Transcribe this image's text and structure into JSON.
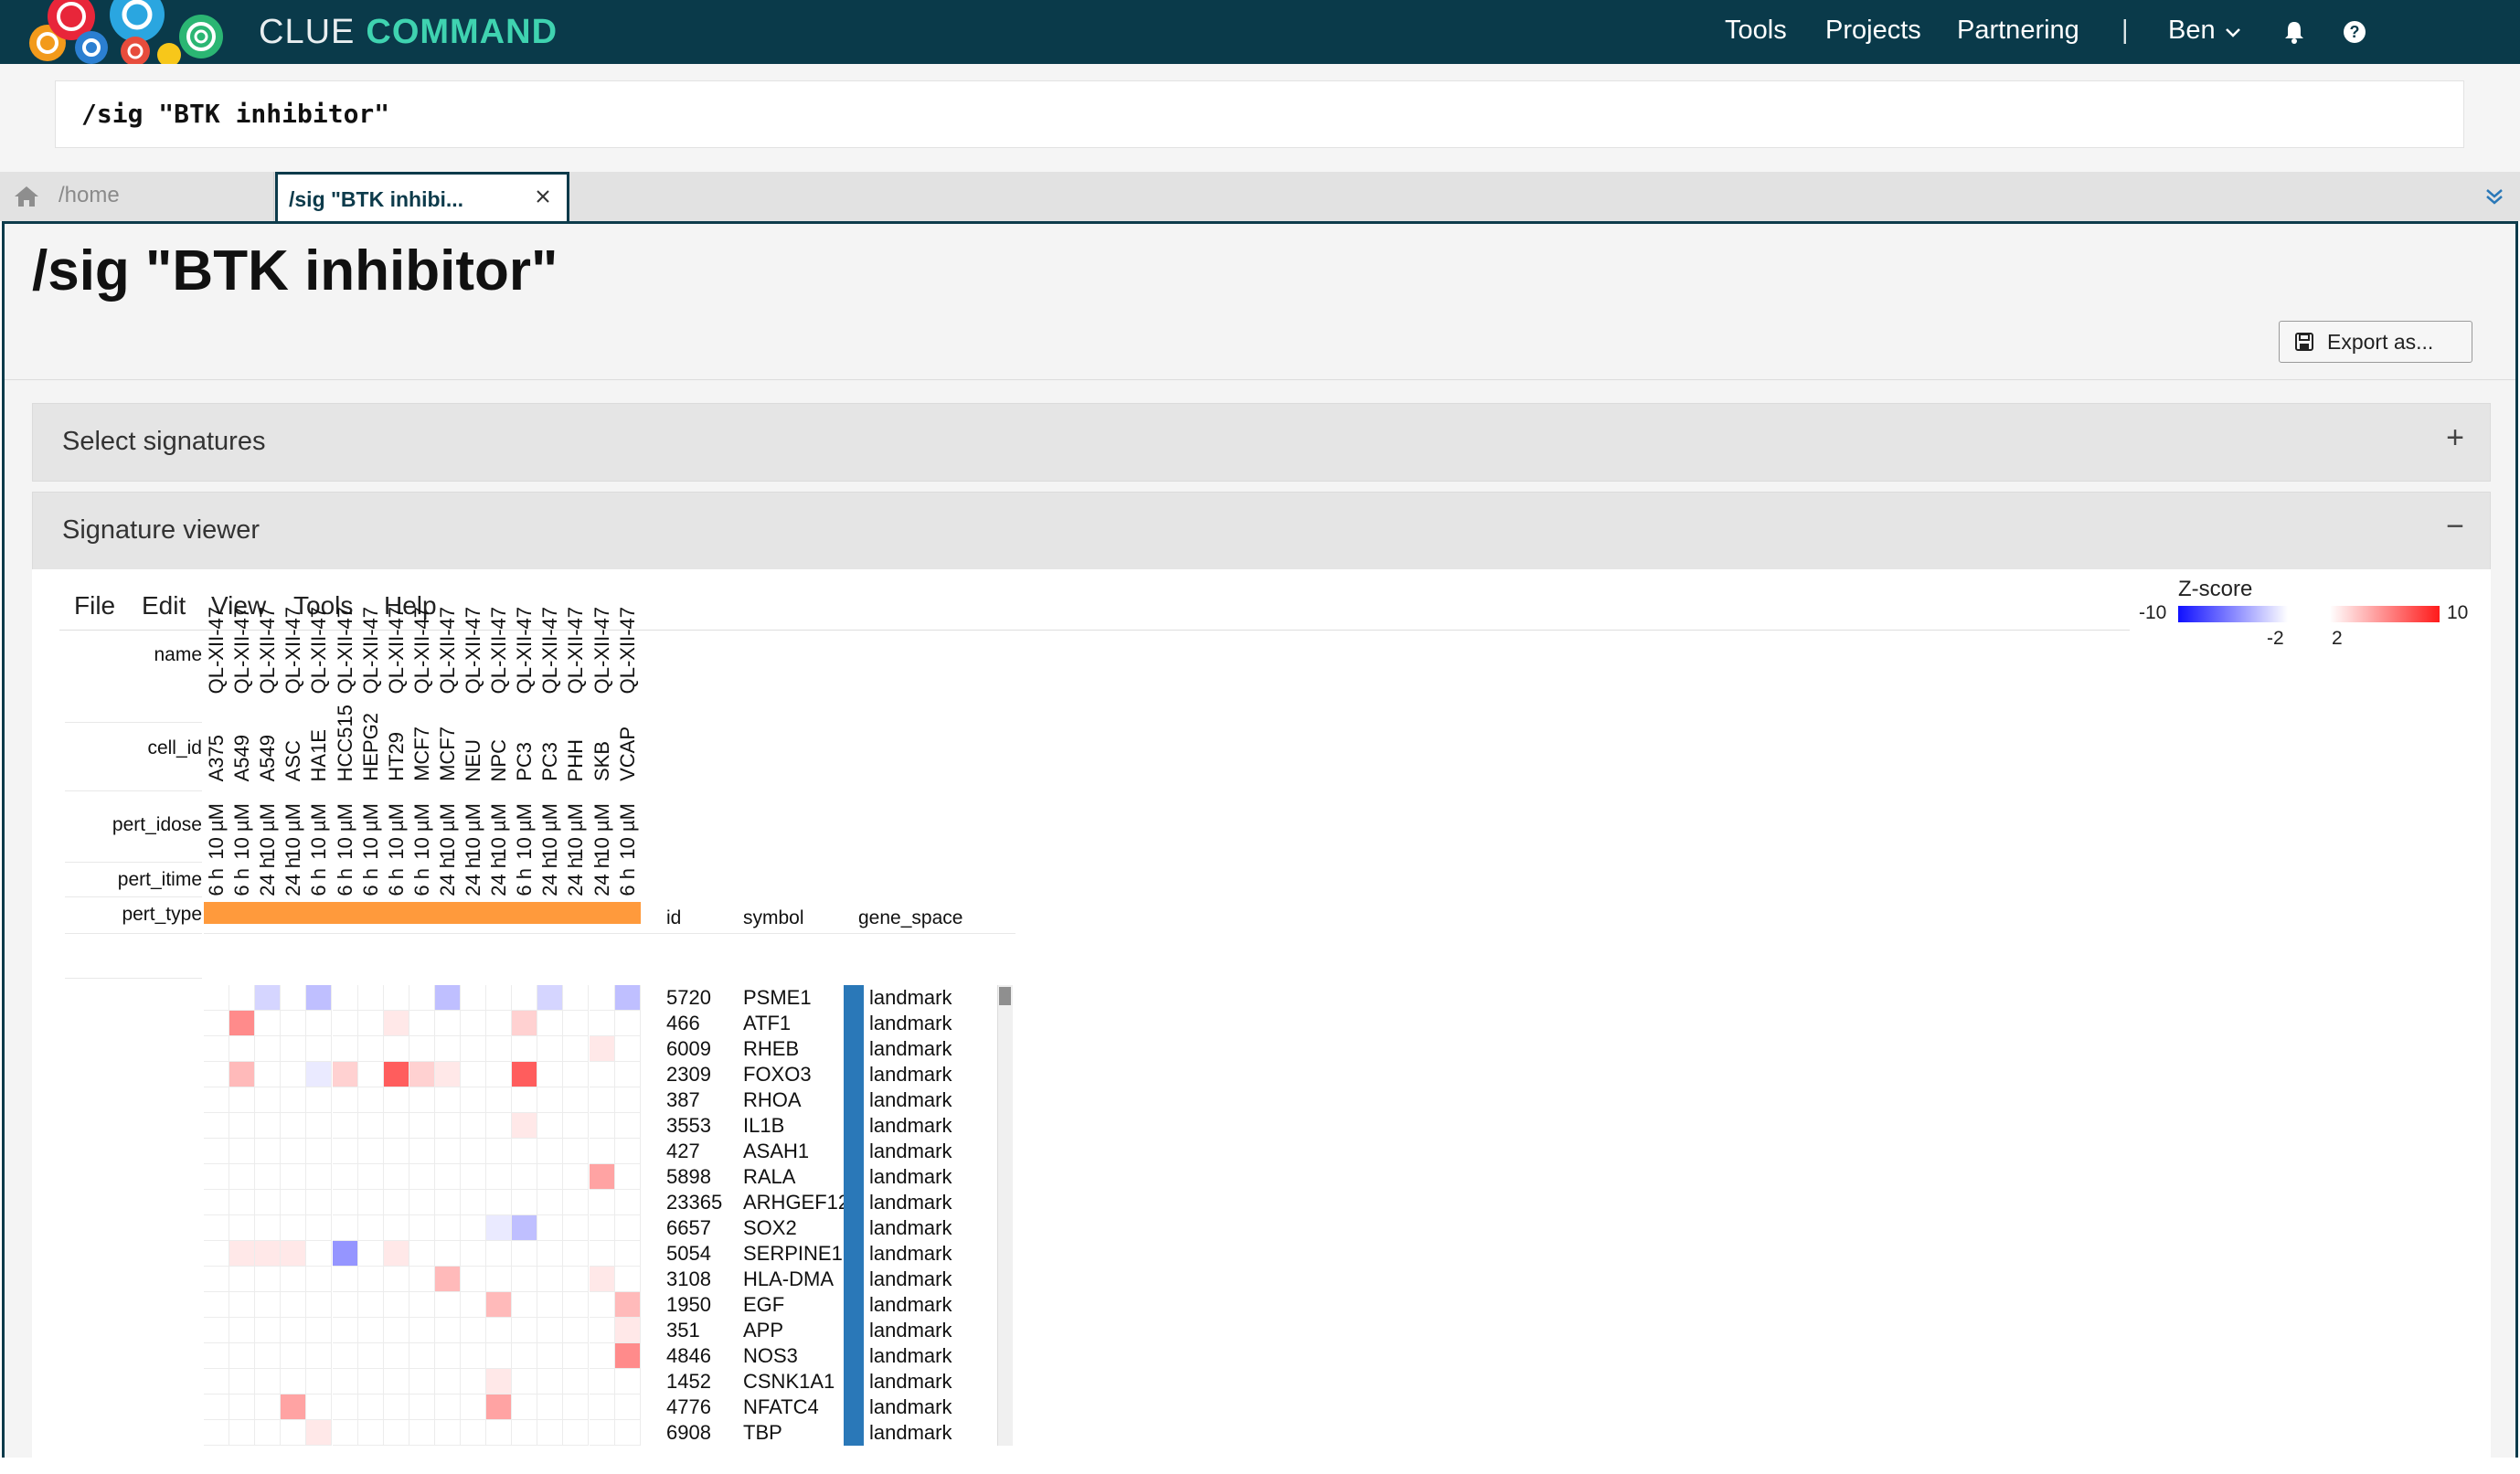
{
  "app": {
    "brand_primary": "CLUE",
    "brand_secondary": "COMMAND",
    "nav": {
      "tools": "Tools",
      "projects": "Projects",
      "partnering": "Partnering",
      "separator": "|",
      "user": "Ben"
    },
    "colors": {
      "navbar": "#0a3a4a",
      "brand_accent": "#3fd3b0",
      "tab_border": "#0d3b4b"
    }
  },
  "command": {
    "value": "/sig \"BTK inhibitor\""
  },
  "tabs": [
    {
      "label": "/home"
    },
    {
      "label": "/sig \"BTK inhibi..."
    }
  ],
  "page": {
    "title": "/sig \"BTK inhibitor\"",
    "export_label": "Export as..."
  },
  "panels": {
    "select": {
      "title": "Select signatures",
      "toggle": "+"
    },
    "viewer": {
      "title": "Signature viewer",
      "toggle": "−"
    }
  },
  "viewer_menu": [
    "File",
    "Edit",
    "View",
    "Tools",
    "Help"
  ],
  "color_scale": {
    "title": "Z-score",
    "min": "-10",
    "max": "10",
    "low_mid": "-2",
    "high_mid": "2",
    "low_color": "#1010ff",
    "high_color": "#ff1a1a"
  },
  "heatmap": {
    "column_fields": [
      "name",
      "cell_id",
      "pert_idose",
      "pert_itime",
      "pert_type"
    ],
    "pert_type_color": "#ff9a3c",
    "columns": [
      {
        "name": "QL-XII-47",
        "cell_id": "A375",
        "pert_idose": "10 µM",
        "pert_itime": "6 h"
      },
      {
        "name": "QL-XII-47",
        "cell_id": "A549",
        "pert_idose": "10 µM",
        "pert_itime": "6 h"
      },
      {
        "name": "QL-XII-47",
        "cell_id": "A549",
        "pert_idose": "10 µM",
        "pert_itime": "24 h"
      },
      {
        "name": "QL-XII-47",
        "cell_id": "ASC",
        "pert_idose": "10 µM",
        "pert_itime": "24 h"
      },
      {
        "name": "QL-XII-47",
        "cell_id": "HA1E",
        "pert_idose": "10 µM",
        "pert_itime": "6 h"
      },
      {
        "name": "QL-XII-47",
        "cell_id": "HCC515",
        "pert_idose": "10 µM",
        "pert_itime": "6 h"
      },
      {
        "name": "QL-XII-47",
        "cell_id": "HEPG2",
        "pert_idose": "10 µM",
        "pert_itime": "6 h"
      },
      {
        "name": "QL-XII-47",
        "cell_id": "HT29",
        "pert_idose": "10 µM",
        "pert_itime": "6 h"
      },
      {
        "name": "QL-XII-47",
        "cell_id": "MCF7",
        "pert_idose": "10 µM",
        "pert_itime": "6 h"
      },
      {
        "name": "QL-XII-47",
        "cell_id": "MCF7",
        "pert_idose": "10 µM",
        "pert_itime": "24 h"
      },
      {
        "name": "QL-XII-47",
        "cell_id": "NEU",
        "pert_idose": "10 µM",
        "pert_itime": "24 h"
      },
      {
        "name": "QL-XII-47",
        "cell_id": "NPC",
        "pert_idose": "10 µM",
        "pert_itime": "24 h"
      },
      {
        "name": "QL-XII-47",
        "cell_id": "PC3",
        "pert_idose": "10 µM",
        "pert_itime": "6 h"
      },
      {
        "name": "QL-XII-47",
        "cell_id": "PC3",
        "pert_idose": "10 µM",
        "pert_itime": "24 h"
      },
      {
        "name": "QL-XII-47",
        "cell_id": "PHH",
        "pert_idose": "10 µM",
        "pert_itime": "24 h"
      },
      {
        "name": "QL-XII-47",
        "cell_id": "SKB",
        "pert_idose": "10 µM",
        "pert_itime": "24 h"
      },
      {
        "name": "QL-XII-47",
        "cell_id": "VCAP",
        "pert_idose": "10 µM",
        "pert_itime": "6 h"
      }
    ],
    "row_table_headers": [
      "id",
      "symbol",
      "gene_space"
    ],
    "gene_space_color": "#2a78b8",
    "rows": [
      {
        "id": "5720",
        "symbol": "PSME1",
        "gene_space": "landmark",
        "z": [
          0,
          0,
          -2,
          0,
          -3,
          0,
          0,
          0,
          0,
          -3,
          0,
          0,
          0,
          -2,
          0,
          0,
          -3
        ]
      },
      {
        "id": "466",
        "symbol": "ATF1",
        "gene_space": "landmark",
        "z": [
          0,
          5,
          0,
          0,
          0,
          0,
          0,
          1,
          0,
          0,
          0,
          0,
          2,
          0,
          0,
          0,
          0
        ]
      },
      {
        "id": "6009",
        "symbol": "RHEB",
        "gene_space": "landmark",
        "z": [
          0,
          0,
          0,
          0,
          0,
          0,
          0,
          0,
          0,
          0,
          0,
          0,
          0,
          0,
          0,
          1,
          0
        ]
      },
      {
        "id": "2309",
        "symbol": "FOXO3",
        "gene_space": "landmark",
        "z": [
          0,
          3,
          0,
          0,
          -1,
          2,
          0,
          7,
          2,
          1,
          0,
          0,
          7,
          0,
          0,
          0,
          0
        ]
      },
      {
        "id": "387",
        "symbol": "RHOA",
        "gene_space": "landmark",
        "z": [
          0,
          0,
          0,
          0,
          0,
          0,
          0,
          0,
          0,
          0,
          0,
          0,
          0,
          0,
          0,
          0,
          0
        ]
      },
      {
        "id": "3553",
        "symbol": "IL1B",
        "gene_space": "landmark",
        "z": [
          0,
          0,
          0,
          0,
          0,
          0,
          0,
          0,
          0,
          0,
          0,
          0,
          1,
          0,
          0,
          0,
          0
        ]
      },
      {
        "id": "427",
        "symbol": "ASAH1",
        "gene_space": "landmark",
        "z": [
          0,
          0,
          0,
          0,
          0,
          0,
          0,
          0,
          0,
          0,
          0,
          0,
          0,
          0,
          0,
          0,
          0
        ]
      },
      {
        "id": "5898",
        "symbol": "RALA",
        "gene_space": "landmark",
        "z": [
          0,
          0,
          0,
          0,
          0,
          0,
          0,
          0,
          0,
          0,
          0,
          0,
          0,
          0,
          0,
          4,
          0
        ]
      },
      {
        "id": "23365",
        "symbol": "ARHGEF12",
        "gene_space": "landmark",
        "z": [
          0,
          0,
          0,
          0,
          0,
          0,
          0,
          0,
          0,
          0,
          0,
          0,
          0,
          0,
          0,
          0,
          0
        ]
      },
      {
        "id": "6657",
        "symbol": "SOX2",
        "gene_space": "landmark",
        "z": [
          0,
          0,
          0,
          0,
          0,
          0,
          0,
          0,
          0,
          0,
          0,
          -1,
          -3,
          0,
          0,
          0,
          0
        ]
      },
      {
        "id": "5054",
        "symbol": "SERPINE1",
        "gene_space": "landmark",
        "z": [
          0,
          1,
          1,
          1,
          0,
          -5,
          0,
          1,
          0,
          0,
          0,
          0,
          0,
          0,
          0,
          0,
          0
        ]
      },
      {
        "id": "3108",
        "symbol": "HLA-DMA",
        "gene_space": "landmark",
        "z": [
          0,
          0,
          0,
          0,
          0,
          0,
          0,
          0,
          0,
          3,
          0,
          0,
          0,
          0,
          0,
          1,
          0
        ]
      },
      {
        "id": "1950",
        "symbol": "EGF",
        "gene_space": "landmark",
        "z": [
          0,
          0,
          0,
          0,
          0,
          0,
          0,
          0,
          0,
          0,
          0,
          3,
          0,
          0,
          0,
          0,
          3
        ]
      },
      {
        "id": "351",
        "symbol": "APP",
        "gene_space": "landmark",
        "z": [
          0,
          0,
          0,
          0,
          0,
          0,
          0,
          0,
          0,
          0,
          0,
          0,
          0,
          0,
          0,
          0,
          1
        ]
      },
      {
        "id": "4846",
        "symbol": "NOS3",
        "gene_space": "landmark",
        "z": [
          0,
          0,
          0,
          0,
          0,
          0,
          0,
          0,
          0,
          0,
          0,
          0,
          0,
          0,
          0,
          0,
          5
        ]
      },
      {
        "id": "1452",
        "symbol": "CSNK1A1",
        "gene_space": "landmark",
        "z": [
          0,
          0,
          0,
          0,
          0,
          0,
          0,
          0,
          0,
          0,
          0,
          1,
          0,
          0,
          0,
          0,
          0
        ]
      },
      {
        "id": "4776",
        "symbol": "NFATC4",
        "gene_space": "landmark",
        "z": [
          0,
          0,
          0,
          4,
          0,
          0,
          0,
          0,
          0,
          0,
          0,
          4,
          0,
          0,
          0,
          0,
          0
        ]
      },
      {
        "id": "6908",
        "symbol": "TBP",
        "gene_space": "landmark",
        "z": [
          0,
          0,
          0,
          0,
          1,
          0,
          0,
          0,
          0,
          0,
          0,
          0,
          0,
          0,
          0,
          0,
          0
        ]
      }
    ]
  }
}
